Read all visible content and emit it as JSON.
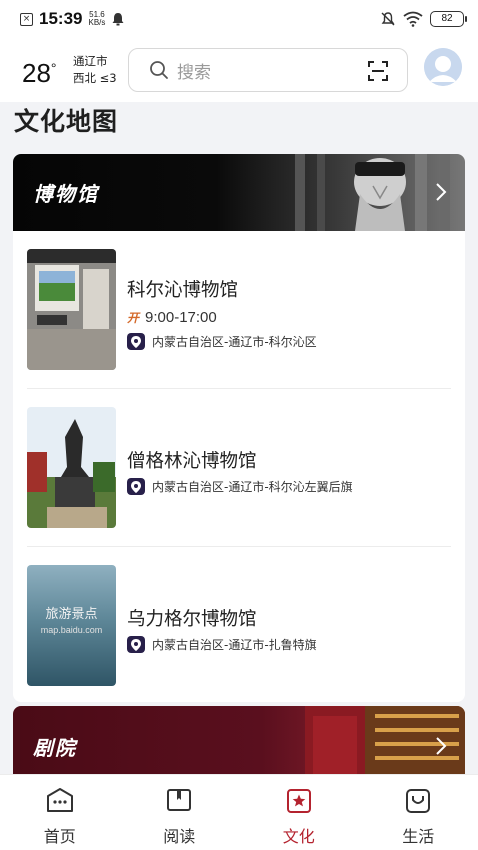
{
  "status_bar": {
    "time": "15:39",
    "speed_value": "51.6",
    "speed_unit": "KB/s",
    "battery": "82"
  },
  "header": {
    "temperature": "28",
    "temp_unit": "°",
    "city": "通辽市",
    "wind": "西北 ≤3",
    "search_placeholder": "搜索"
  },
  "section_title": "文化地图",
  "museum_card": {
    "title": "博物馆",
    "items": [
      {
        "name": "科尔沁博物馆",
        "open_badge": "开",
        "hours": "9:00-17:00",
        "address": "内蒙古自治区-通辽市-科尔沁区"
      },
      {
        "name": "僧格林沁博物馆",
        "address": "内蒙古自治区-通辽市-科尔沁左翼后旗"
      },
      {
        "name": "乌力格尔博物馆",
        "address": "内蒙古自治区-通辽市-扎鲁特旗",
        "thumb_text": "旅游景点",
        "thumb_subtext": "map.baidu.com"
      }
    ]
  },
  "theater_card": {
    "title": "剧院"
  },
  "bottom_nav": [
    {
      "label": "首页",
      "icon": "home-icon"
    },
    {
      "label": "阅读",
      "icon": "book-icon"
    },
    {
      "label": "文化",
      "icon": "culture-star-icon",
      "active": true
    },
    {
      "label": "生活",
      "icon": "life-icon"
    }
  ],
  "colors": {
    "accent": "#b4232f",
    "pin": "#28204a",
    "open_badge": "#d4692a"
  }
}
